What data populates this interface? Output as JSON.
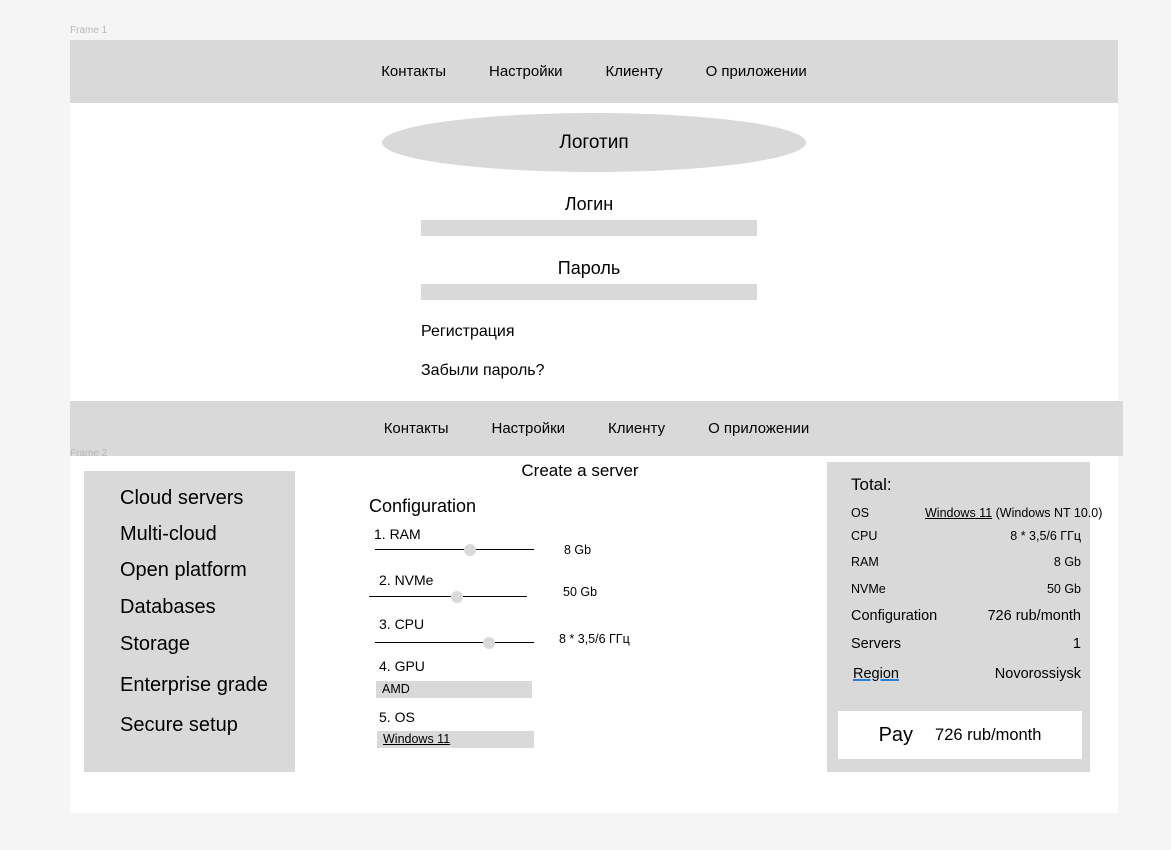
{
  "frames": {
    "frame1_label": "Frame 1",
    "frame2_label": "Frame 2"
  },
  "nav": {
    "items": [
      "Контакты",
      "Настройки",
      "Клиенту",
      "О приложении"
    ]
  },
  "login": {
    "logo_text": "Логотип",
    "login_label": "Логин",
    "login_value": "",
    "password_label": "Пароль",
    "password_value": "",
    "register_link": "Регистрация",
    "forgot_link": "Забыли пароль?"
  },
  "sidebar": {
    "items": [
      "Cloud servers",
      "Multi-cloud",
      "Open platform",
      "Databases",
      "Storage",
      "Enterprise grade",
      "Secure setup"
    ]
  },
  "config": {
    "page_title": "Create a server",
    "title": "Configuration",
    "ram": {
      "label": "1. RAM",
      "value": "8 Gb",
      "level": 0.6
    },
    "nvme": {
      "label": "2. NVMe",
      "value": "50 Gb",
      "level": 0.56
    },
    "cpu": {
      "label": "3. CPU",
      "value": "8 * 3,5/6 ГГц",
      "level": 0.72
    },
    "gpu": {
      "label": "4. GPU",
      "selected": "AMD"
    },
    "os": {
      "label": "5. OS",
      "selected": "Windows 11"
    }
  },
  "total": {
    "title": "Total:",
    "os": {
      "label": "OS",
      "name": "Windows 11",
      "detail": " (Windows NT 10.0)"
    },
    "cpu": {
      "label": "CPU",
      "value": "8 * 3,5/6 ГГц"
    },
    "ram": {
      "label": "RAM",
      "value": "8 Gb"
    },
    "nvme": {
      "label": "NVMe",
      "value": "50 Gb"
    },
    "configuration": {
      "label": "Configuration",
      "value": "726 rub/month"
    },
    "servers": {
      "label": "Servers",
      "value": "1"
    },
    "region": {
      "label": "Region",
      "value": "Novorossiysk"
    },
    "pay": {
      "label": "Pay",
      "amount": "726 rub/month"
    }
  }
}
